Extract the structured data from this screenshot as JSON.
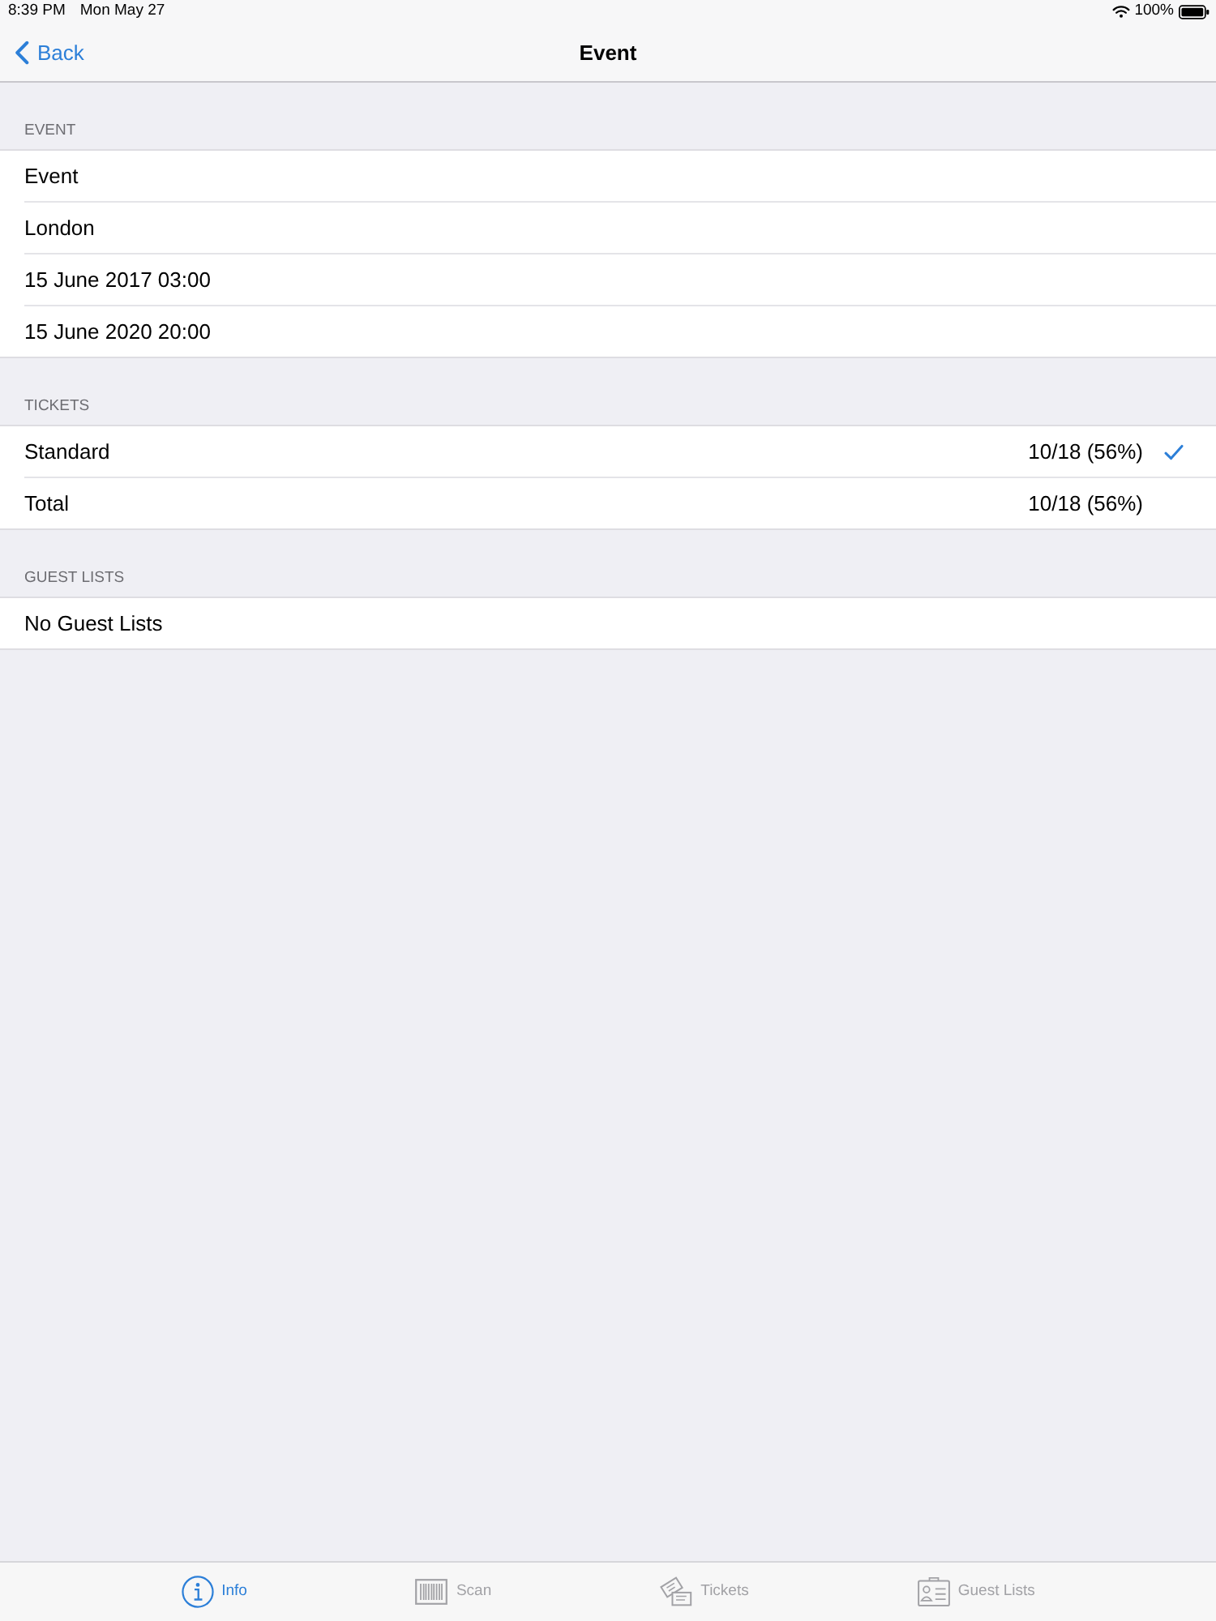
{
  "status_bar": {
    "time": "8:39 PM",
    "date": "Mon May 27",
    "battery": "100%"
  },
  "nav_bar": {
    "back": "Back",
    "title": "Event"
  },
  "sections": [
    {
      "header": "EVENT",
      "rows": [
        {
          "label": "Event"
        },
        {
          "label": "London"
        },
        {
          "label": "15 June 2017 03:00"
        },
        {
          "label": "15 June 2020 20:00"
        }
      ]
    },
    {
      "header": "TICKETS",
      "rows": [
        {
          "label": "Standard",
          "value": "10/18 (56%)",
          "checked": true
        },
        {
          "label": "Total",
          "value": "10/18 (56%)",
          "checked": false
        }
      ]
    },
    {
      "header": "GUEST LISTS",
      "rows": [
        {
          "label": "No Guest Lists"
        }
      ]
    }
  ],
  "tab_bar": [
    {
      "kind": "info",
      "label": "Info",
      "selected": true
    },
    {
      "kind": "scan",
      "label": "Scan",
      "selected": false
    },
    {
      "kind": "tickets",
      "label": "Tickets",
      "selected": false
    },
    {
      "kind": "guests",
      "label": "Guest Lists",
      "selected": false
    }
  ]
}
